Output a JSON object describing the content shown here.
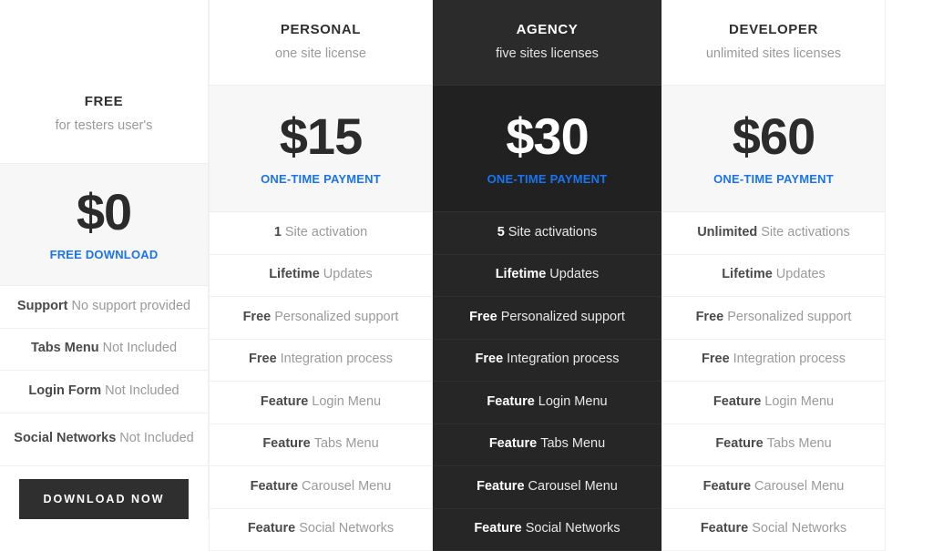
{
  "accent_color": "#1a73f0",
  "dark_color": "#2b2b2b",
  "columns": [
    {
      "key": "free",
      "highlighted": false,
      "plan_name": "FREE",
      "plan_sub": "for testers user's",
      "price": "$0",
      "price_note": "FREE DOWNLOAD",
      "features": [
        {
          "strong": "Support",
          "text": "No support provided"
        },
        {
          "strong": "Tabs Menu",
          "text": "Not Included"
        },
        {
          "strong": "Login Form",
          "text": "Not Included"
        },
        {
          "strong": "Social Networks",
          "text": "Not Included"
        }
      ],
      "cta_label": "Download Now"
    },
    {
      "key": "personal",
      "highlighted": false,
      "plan_name": "PERSONAL",
      "plan_sub": "one site license",
      "price": "$15",
      "price_note": "ONE-TIME PAYMENT",
      "features": [
        {
          "strong": "1",
          "text": "Site activation"
        },
        {
          "strong": "Lifetime",
          "text": "Updates"
        },
        {
          "strong": "Free",
          "text": "Personalized support"
        },
        {
          "strong": "Free",
          "text": "Integration process"
        },
        {
          "strong": "Feature",
          "text": "Login Menu"
        },
        {
          "strong": "Feature",
          "text": "Tabs Menu"
        },
        {
          "strong": "Feature",
          "text": "Carousel Menu"
        },
        {
          "strong": "Feature",
          "text": "Social Networks"
        }
      ]
    },
    {
      "key": "agency",
      "highlighted": true,
      "plan_name": "AGENCY",
      "plan_sub": "five sites licenses",
      "price": "$30",
      "price_note": "ONE-TIME PAYMENT",
      "features": [
        {
          "strong": "5",
          "text": "Site activations"
        },
        {
          "strong": "Lifetime",
          "text": "Updates"
        },
        {
          "strong": "Free",
          "text": "Personalized support"
        },
        {
          "strong": "Free",
          "text": "Integration process"
        },
        {
          "strong": "Feature",
          "text": "Login Menu"
        },
        {
          "strong": "Feature",
          "text": "Tabs Menu"
        },
        {
          "strong": "Feature",
          "text": "Carousel Menu"
        },
        {
          "strong": "Feature",
          "text": "Social Networks"
        }
      ]
    },
    {
      "key": "developer",
      "highlighted": false,
      "plan_name": "DEVELOPER",
      "plan_sub": "unlimited sites licenses",
      "price": "$60",
      "price_note": "ONE-TIME PAYMENT",
      "features": [
        {
          "strong": "Unlimited",
          "text": "Site activations"
        },
        {
          "strong": "Lifetime",
          "text": "Updates"
        },
        {
          "strong": "Free",
          "text": "Personalized support"
        },
        {
          "strong": "Free",
          "text": "Integration process"
        },
        {
          "strong": "Feature",
          "text": "Login Menu"
        },
        {
          "strong": "Feature",
          "text": "Tabs Menu"
        },
        {
          "strong": "Feature",
          "text": "Carousel Menu"
        },
        {
          "strong": "Feature",
          "text": "Social Networks"
        }
      ]
    }
  ]
}
